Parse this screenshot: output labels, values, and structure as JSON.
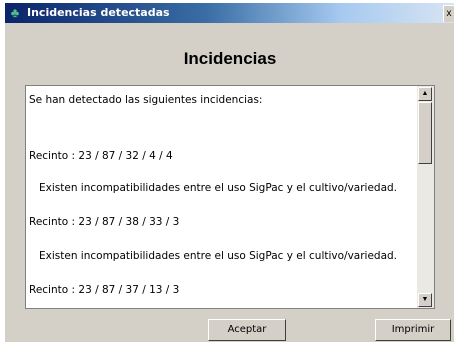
{
  "window": {
    "title": "Incidencias detectadas",
    "close_label": "x"
  },
  "dialog": {
    "heading": "Incidencias"
  },
  "incidencias": {
    "lines": [
      "Se han detectado las siguientes incidencias:",
      "Recinto : 23 / 87 / 32 / 4 / 4",
      "Existen incompatibilidades entre el uso SigPac y el cultivo/variedad.",
      "Recinto : 23 / 87 / 38 / 33 / 3",
      "Existen incompatibilidades entre el uso SigPac y el cultivo/variedad.",
      "Recinto : 23 / 87 / 37 / 13 / 3"
    ]
  },
  "buttons": {
    "accept": "Aceptar",
    "print": "Imprimir"
  }
}
